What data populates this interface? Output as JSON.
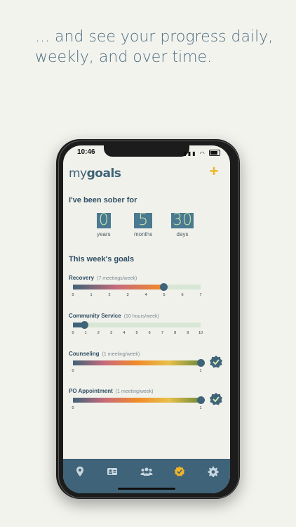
{
  "headline": "... and see your progress daily, weekly, and over time.",
  "status_bar": {
    "time": "10:46"
  },
  "app": {
    "logo_prefix": "my",
    "logo_bold": "goals",
    "add_icon": "plus-icon"
  },
  "sober": {
    "title": "I've been sober for",
    "counters": [
      {
        "value": "0",
        "unit": "years"
      },
      {
        "value": "5",
        "unit": "months"
      },
      {
        "value": "30",
        "unit": "days"
      }
    ]
  },
  "week": {
    "title": "This week's goals",
    "goals": [
      {
        "name": "Recovery",
        "target": "(7 meetings/week)",
        "ticks": [
          "0",
          "1",
          "2",
          "3",
          "4",
          "5",
          "6",
          "7"
        ],
        "progress": 0.71,
        "complete": false
      },
      {
        "name": "Community Service",
        "target": "(10 hours/week)",
        "ticks": [
          "0",
          "1",
          "2",
          "3",
          "4",
          "5",
          "6",
          "7",
          "8",
          "9",
          "10"
        ],
        "progress": 0.09,
        "complete": false
      },
      {
        "name": "Counseling",
        "target": "(1 meeting/week)",
        "ticks": [
          "0",
          "1"
        ],
        "progress": 1.0,
        "complete": true
      },
      {
        "name": "PO Appointment",
        "target": "(1 meeting/week)",
        "ticks": [
          "0",
          "1"
        ],
        "progress": 1.0,
        "complete": true
      }
    ]
  },
  "tabbar": {
    "items": [
      "location-pin-icon",
      "id-card-icon",
      "group-icon",
      "goals-badge-icon",
      "gear-icon"
    ],
    "active_index": 3
  },
  "colors": {
    "primary": "#3f6378",
    "accent": "#f0b429",
    "gradient": [
      "#3f6378",
      "#c96a7a",
      "#f08a2a",
      "#e8c04a",
      "#6f8a3a"
    ]
  }
}
